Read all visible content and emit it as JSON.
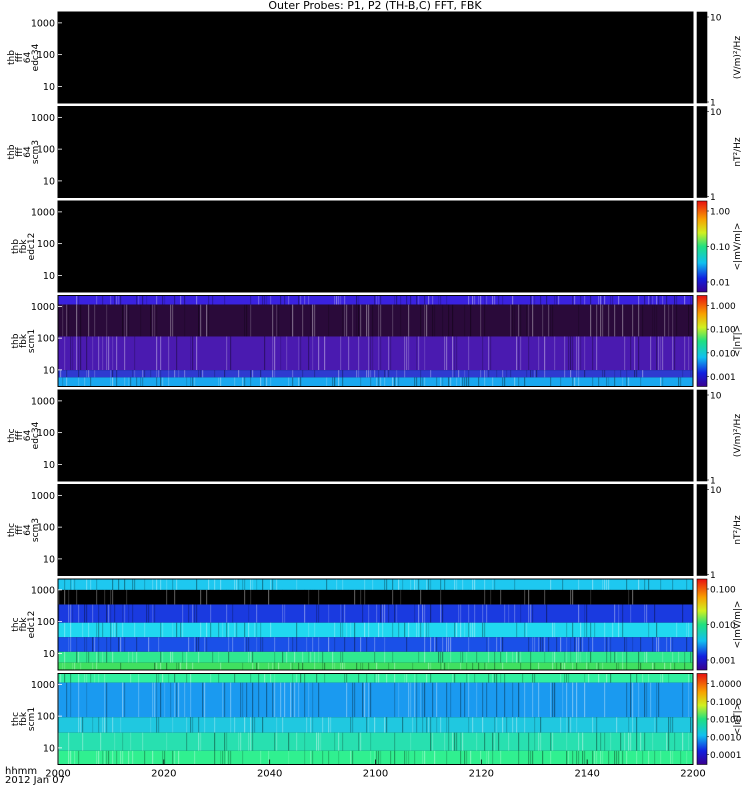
{
  "title": "Outer Probes: P1, P2 (TH-B,C) FFT, FBK",
  "time_axis": {
    "unit_label": "hhmm",
    "date_label": "2012 Jan 07",
    "tick_labels": [
      "2000",
      "2020",
      "2040",
      "2100",
      "2120",
      "2140",
      "2200"
    ]
  },
  "chart_data": [
    {
      "type": "heatmap",
      "ylabel_lines": [
        "thb",
        "fff",
        "64",
        "edc34"
      ],
      "yticks": [
        "10",
        "100",
        "1000"
      ],
      "colorbar_label": "(V/m)²/Hz",
      "colorbar_ticks": [
        "10",
        "1"
      ],
      "colormap": "black",
      "content": "no data (black)"
    },
    {
      "type": "heatmap",
      "ylabel_lines": [
        "thb",
        "fff",
        "64",
        "scm3"
      ],
      "yticks": [
        "10",
        "100",
        "1000"
      ],
      "colorbar_label": "nT²/Hz",
      "colorbar_ticks": [
        "10",
        "1"
      ],
      "colormap": "black",
      "content": "no data (black)"
    },
    {
      "type": "heatmap",
      "ylabel_lines": [
        "thb",
        "fbk",
        "edc12"
      ],
      "yticks": [
        "10",
        "100",
        "1000"
      ],
      "colorbar_label": "<|mV/m|>",
      "colorbar_ticks": [
        "1.00",
        "0.10",
        "0.01"
      ],
      "colormap": "rainbow",
      "content": "no data (black)"
    },
    {
      "type": "heatmap",
      "ylabel_lines": [
        "thb",
        "fbk",
        "scm1"
      ],
      "yticks": [
        "10",
        "100",
        "1000"
      ],
      "colorbar_label": "<|nT|>",
      "colorbar_ticks": [
        "1.000",
        "0.100",
        "0.010",
        "0.001"
      ],
      "colormap": "rainbow",
      "content": "spectrogram",
      "bands": [
        {
          "from": 1.0,
          "to": 0.9,
          "color": "#3a22e0"
        },
        {
          "from": 0.9,
          "to": 0.55,
          "color": "#2a0a3a"
        },
        {
          "from": 0.55,
          "to": 0.18,
          "color": "#4a1ab0"
        },
        {
          "from": 0.18,
          "to": 0.1,
          "color": "#2e3ad0"
        },
        {
          "from": 0.1,
          "to": 0.0,
          "color": "#19a8f0"
        }
      ]
    },
    {
      "type": "heatmap",
      "ylabel_lines": [
        "thc",
        "fff",
        "64",
        "edc34"
      ],
      "yticks": [
        "10",
        "100",
        "1000"
      ],
      "colorbar_label": "(V/m)²/Hz",
      "colorbar_ticks": [
        "10",
        "1"
      ],
      "colormap": "black",
      "content": "no data (black)"
    },
    {
      "type": "heatmap",
      "ylabel_lines": [
        "thc",
        "fff",
        "64",
        "scm3"
      ],
      "yticks": [
        "10",
        "100",
        "1000"
      ],
      "colorbar_label": "nT²/Hz",
      "colorbar_ticks": [
        "10",
        "1"
      ],
      "colormap": "black",
      "content": "no data (black)"
    },
    {
      "type": "heatmap",
      "ylabel_lines": [
        "thc",
        "fbk",
        "edc12"
      ],
      "yticks": [
        "10",
        "100",
        "1000"
      ],
      "colorbar_label": "<|mV/m|>",
      "colorbar_ticks": [
        "0.100",
        "0.010",
        "0.001"
      ],
      "colormap": "rainbow",
      "content": "spectrogram",
      "bands": [
        {
          "from": 1.0,
          "to": 0.88,
          "color": "#1ec8f0"
        },
        {
          "from": 0.88,
          "to": 0.72,
          "color": "#000000"
        },
        {
          "from": 0.72,
          "to": 0.52,
          "color": "#1a3ae0"
        },
        {
          "from": 0.52,
          "to": 0.36,
          "color": "#20d8f0"
        },
        {
          "from": 0.36,
          "to": 0.2,
          "color": "#1a50e8"
        },
        {
          "from": 0.2,
          "to": 0.08,
          "color": "#30e890"
        },
        {
          "from": 0.08,
          "to": 0.0,
          "color": "#40e060"
        }
      ]
    },
    {
      "type": "heatmap",
      "ylabel_lines": [
        "thc",
        "fbk",
        "scm1"
      ],
      "yticks": [
        "10",
        "100",
        "1000"
      ],
      "colorbar_label": "<|nT|>",
      "colorbar_ticks": [
        "1.0000",
        "0.1000",
        "0.0100",
        "0.0010",
        "0.0001"
      ],
      "colormap": "rainbow",
      "content": "spectrogram",
      "bands": [
        {
          "from": 1.0,
          "to": 0.9,
          "color": "#30f0a0"
        },
        {
          "from": 0.9,
          "to": 0.52,
          "color": "#1a9af0"
        },
        {
          "from": 0.52,
          "to": 0.35,
          "color": "#20c8e0"
        },
        {
          "from": 0.35,
          "to": 0.15,
          "color": "#28e0b0"
        },
        {
          "from": 0.15,
          "to": 0.0,
          "color": "#30f090"
        }
      ]
    }
  ]
}
